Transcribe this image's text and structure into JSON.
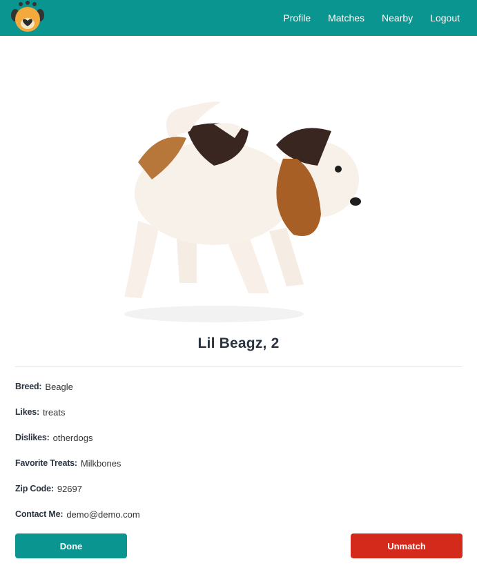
{
  "nav": {
    "logo_icon": "dog-face-heart-logo",
    "links": [
      "Profile",
      "Matches",
      "Nearby",
      "Logout"
    ]
  },
  "profile": {
    "photo_icon": "beagle-puppy-photo",
    "title": "Lil Beagz, 2",
    "details": [
      {
        "label": "Breed:",
        "value": "Beagle"
      },
      {
        "label": "Likes:",
        "value": "treats"
      },
      {
        "label": "Dislikes:",
        "value": "otherdogs"
      },
      {
        "label": "Favorite Treats:",
        "value": "Milkbones"
      },
      {
        "label": "Zip Code:",
        "value": "92697"
      },
      {
        "label": "Contact Me:",
        "value": "demo@demo.com"
      }
    ]
  },
  "actions": {
    "done_label": "Done",
    "unmatch_label": "Unmatch"
  },
  "colors": {
    "teal": "#0b9590",
    "red": "#d42a1c"
  }
}
